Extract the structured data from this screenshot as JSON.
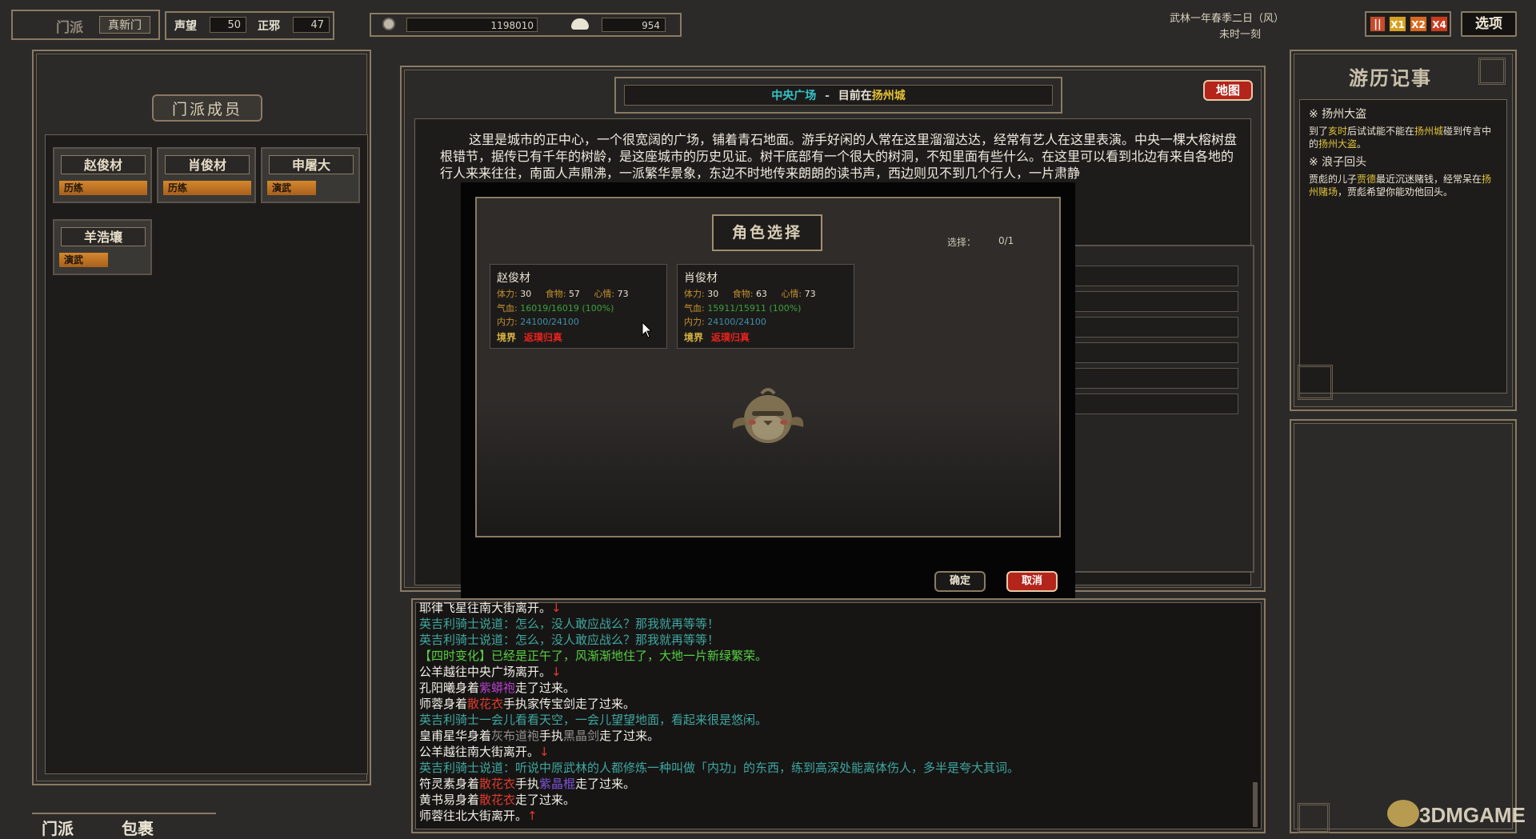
{
  "topbar": {
    "sect_label": "门派",
    "sect_name": "真新门",
    "reputation_label": "声望",
    "reputation_value": "50",
    "alignment_label": "正邪",
    "alignment_value": "47",
    "money_value": "1198010",
    "food_value": "954",
    "date_line1": "武林一年春季二日（风）",
    "date_line2": "未时一刻",
    "speed_buttons": [
      "||",
      "X1",
      "X2",
      "X4"
    ],
    "options_label": "选项"
  },
  "left_panel": {
    "title": "门派成员",
    "members": [
      {
        "name": "赵俊材",
        "tag": "历练",
        "tag_fill": 1.0
      },
      {
        "name": "肖俊材",
        "tag": "历练",
        "tag_fill": 1.0
      },
      {
        "name": "申屠大",
        "tag": "演武",
        "tag_fill": 0.55
      },
      {
        "name": "羊浩壤",
        "tag": "演武",
        "tag_fill": 0.55
      }
    ],
    "bottom_tabs": [
      "门派",
      "包裹"
    ]
  },
  "location": {
    "place": "中央广场",
    "separator": "-",
    "current_prefix": "目前在",
    "city": "扬州城",
    "map_button": "地图",
    "description": "这里是城市的正中心，一个很宽阔的广场，铺着青石地面。游手好闲的人常在这里溜溜达达，经常有艺人在这里表演。中央一棵大榕树盘根错节，据传已有千年的树龄，是这座城市的历史见证。树干底部有一个很大的树洞，不知里面有些什么。在这里可以看到北边有来自各地的行人来来往往，南面人声鼎沸，一派繁华景象，东边不时地传来朗朗的读书声，西边则见不到几个行人，一片肃",
    "description_tail": "静"
  },
  "dialog": {
    "title": "角色选择",
    "select_label": "选择：",
    "select_count": "0/1",
    "characters": [
      {
        "name": "赵俊材",
        "stamina_label": "体力:",
        "stamina": "30",
        "food_label": "食物:",
        "food": "57",
        "mood_label": "心情:",
        "mood": "73",
        "hp_label": "气血:",
        "hp": "16019/16019 (100%)",
        "mp_label": "内力:",
        "mp": "24100/24100",
        "realm_label": "境界",
        "realm": "返璞归真"
      },
      {
        "name": "肖俊材",
        "stamina_label": "体力:",
        "stamina": "30",
        "food_label": "食物:",
        "food": "63",
        "mood_label": "心情:",
        "mood": "73",
        "hp_label": "气血:",
        "hp": "15911/15911 (100%)",
        "mp_label": "内力:",
        "mp": "24100/24100",
        "realm_label": "境界",
        "realm": "返璞归真"
      }
    ],
    "confirm_label": "确定",
    "cancel_label": "取消"
  },
  "right_panel": {
    "title": "游历记事",
    "entries": [
      {
        "head": "※ 扬州大盗",
        "body_parts": [
          "到了",
          "亥时",
          "后试试能不能在",
          "扬州城",
          "碰到传言中的",
          "扬州大盗",
          "。"
        ]
      },
      {
        "head": "※ 浪子回头",
        "body_parts": [
          "贾彪的儿子",
          "贾德",
          "最近沉迷赌钱，经常呆在",
          "扬州赌场",
          "，贾彪希望你能劝他回头。"
        ]
      }
    ]
  },
  "log": {
    "lines": [
      [
        {
          "t": "耶律飞星往南大街离开。",
          "c": "white"
        },
        {
          "t": "↓",
          "c": "red"
        }
      ],
      [
        {
          "t": "英吉利骑士说道：怎么，没人敢应战么？那我就再等等！",
          "c": "cyan"
        }
      ],
      [
        {
          "t": "英吉利骑士说道：怎么，没人敢应战么？那我就再等等！",
          "c": "cyan"
        }
      ],
      [
        {
          "t": "【四时变化】已经是正午了，风渐渐地住了，大地一片新绿繁荣。",
          "c": "green"
        }
      ],
      [
        {
          "t": "公羊越往中央广场离开。",
          "c": "white"
        },
        {
          "t": "↓",
          "c": "red"
        }
      ],
      [
        {
          "t": "孔阳曦身着",
          "c": "white"
        },
        {
          "t": "紫蟒袍",
          "c": "purple"
        },
        {
          "t": "走了过来。",
          "c": "white"
        }
      ],
      [
        {
          "t": "师蓉身着",
          "c": "white"
        },
        {
          "t": "散花衣",
          "c": "red"
        },
        {
          "t": "手执家传宝剑走了过来。",
          "c": "white"
        }
      ],
      [
        {
          "t": "英吉利骑士一会儿看看天空，一会儿望望地面，看起来很是悠闲。",
          "c": "cyan"
        }
      ],
      [
        {
          "t": "皇甫星华身着",
          "c": "white"
        },
        {
          "t": "灰布道袍",
          "c": "gray"
        },
        {
          "t": "手执",
          "c": "white"
        },
        {
          "t": "黑晶剑",
          "c": "gray"
        },
        {
          "t": "走了过来。",
          "c": "white"
        }
      ],
      [
        {
          "t": "公羊越往南大街离开。",
          "c": "white"
        },
        {
          "t": "↓",
          "c": "red"
        }
      ],
      [
        {
          "t": "英吉利骑士说道：听说中原武林的人都修炼一种叫做「内功」的东西，练到高深处能离体伤人，多半是夸大其词。",
          "c": "cyan"
        }
      ],
      [
        {
          "t": "符灵素身着",
          "c": "white"
        },
        {
          "t": "散花衣",
          "c": "red"
        },
        {
          "t": "手执",
          "c": "white"
        },
        {
          "t": "紫晶棍",
          "c": "violet"
        },
        {
          "t": "走了过来。",
          "c": "white"
        }
      ],
      [
        {
          "t": "黄书易身着",
          "c": "white"
        },
        {
          "t": "散花衣",
          "c": "red"
        },
        {
          "t": "走了过来。",
          "c": "white"
        }
      ],
      [
        {
          "t": "师蓉往北大街离开。",
          "c": "white"
        },
        {
          "t": "↑",
          "c": "red"
        }
      ]
    ]
  },
  "watermark": "3DMGAME",
  "colors": {
    "accent_red": "#b3241b",
    "frame": "#8a7a63",
    "bg": "#2b2a29"
  }
}
